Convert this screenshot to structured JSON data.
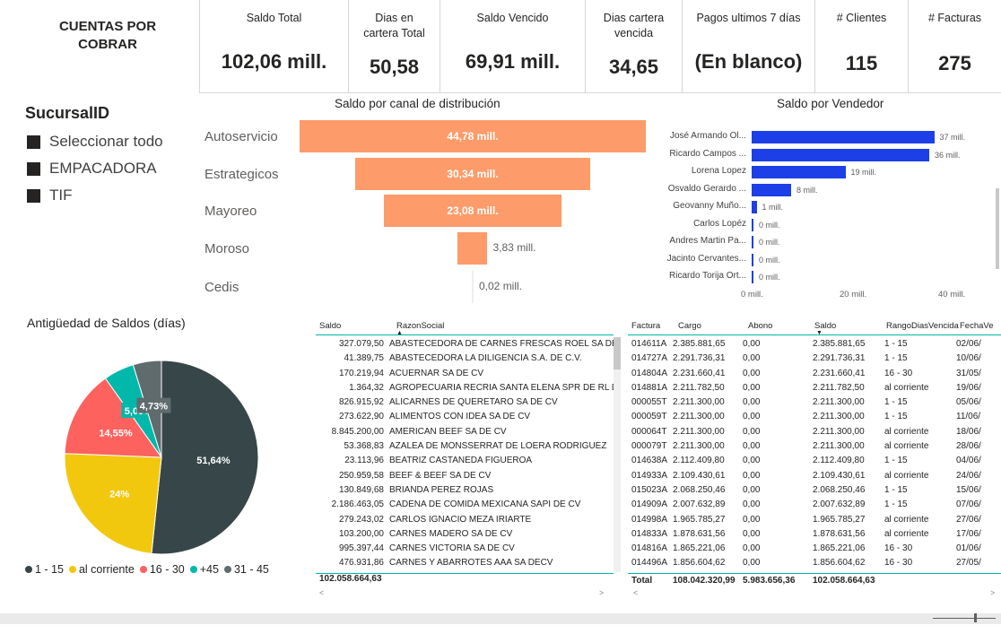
{
  "report_title": "CUENTAS POR COBRAR",
  "cards": [
    {
      "label": "Saldo Total",
      "value": "102,06 mill."
    },
    {
      "label": "Dias en cartera Total",
      "value": "50,58"
    },
    {
      "label": "Saldo Vencido",
      "value": "69,91 mill."
    },
    {
      "label": "Dias cartera vencida",
      "value": "34,65"
    },
    {
      "label": "Pagos ultimos 7 días",
      "value": "(En blanco)"
    },
    {
      "label": "# Clientes",
      "value": "115"
    },
    {
      "label": "# Facturas",
      "value": "275"
    }
  ],
  "slicer": {
    "title": "SucursalID",
    "items": [
      "Seleccionar todo",
      "EMPACADORA",
      "TIF"
    ]
  },
  "funnel": {
    "title": "Saldo por canal de distribución",
    "color": "#fd9b6a",
    "rows": [
      {
        "label": "Autoservicio",
        "value": 44.78,
        "display": "44,78 mill."
      },
      {
        "label": "Estrategicos",
        "value": 30.34,
        "display": "30,34 mill."
      },
      {
        "label": "Mayoreo",
        "value": 23.08,
        "display": "23,08 mill."
      },
      {
        "label": "Moroso",
        "value": 3.83,
        "display": "3,83 mill."
      },
      {
        "label": "Cedis",
        "value": 0.02,
        "display": "0,02 mill."
      }
    ]
  },
  "vendedor": {
    "title": "Saldo por Vendedor",
    "color": "#1c3fe8",
    "axis_ticks": [
      "0 mill.",
      "20 mill.",
      "40 mill."
    ],
    "rows": [
      {
        "label": "José Armando Ol...",
        "value": 37,
        "display": "37 mill."
      },
      {
        "label": "Ricardo Campos ...",
        "value": 36,
        "display": "36 mill."
      },
      {
        "label": "Lorena Lopez",
        "value": 19,
        "display": "19 mill."
      },
      {
        "label": "Osvaldo Gerardo ...",
        "value": 8,
        "display": "8 mill."
      },
      {
        "label": "Geovanny Muño...",
        "value": 1,
        "display": "1 mill."
      },
      {
        "label": "Carlos Lopéz",
        "value": 0,
        "display": "0 mill."
      },
      {
        "label": "Andres Martin Pa...",
        "value": 0,
        "display": "0 mill."
      },
      {
        "label": "Jacinto Cervantes...",
        "value": 0,
        "display": "0 mill."
      },
      {
        "label": "Ricardo Torija Ort...",
        "value": 0,
        "display": "0 mill."
      }
    ]
  },
  "pie": {
    "title": "Antigüedad de Saldos (días)",
    "slices": [
      {
        "name": "31 - 45",
        "value": 51.64,
        "label": "51,64%",
        "color": "#374649"
      },
      {
        "name": "al corriente",
        "value": 24,
        "label": "24%",
        "color": "#f2c80f"
      },
      {
        "name": "1 - 15",
        "value": 14.55,
        "label": "14,55%",
        "color": "#fd625e"
      },
      {
        "name": "16 - 30",
        "value": 5.09,
        "label": "5,09%",
        "color": "#01b8aa"
      },
      {
        "name": "+45",
        "value": 4.73,
        "label": "4,73%",
        "color": "#5f6b6d"
      }
    ],
    "legend": [
      {
        "name": "1 - 15",
        "color": "#374649"
      },
      {
        "name": "al corriente",
        "color": "#f2c80f"
      },
      {
        "name": "16 - 30",
        "color": "#fd625e"
      },
      {
        "name": "+45",
        "color": "#01b8aa"
      },
      {
        "name": "31 - 45",
        "color": "#5f6b6d"
      }
    ]
  },
  "table1": {
    "headers": [
      "Saldo",
      "RazonSocial"
    ],
    "rows": [
      [
        "327.079,50",
        "ABASTECEDORA DE CARNES FRESCAS ROEL SA DE C"
      ],
      [
        "41.389,75",
        "ABASTECEDORA LA DILIGENCIA S.A. DE C.V."
      ],
      [
        "170.219,94",
        "ACUERNAR SA DE CV"
      ],
      [
        "1.364,32",
        "AGROPECUARIA RECRIA SANTA ELENA SPR DE RL DE"
      ],
      [
        "826.915,92",
        "ALICARNES DE QUERETARO SA DE CV"
      ],
      [
        "273.622,90",
        "ALIMENTOS CON IDEA SA DE CV"
      ],
      [
        "8.845.200,00",
        "AMERICAN BEEF SA DE CV"
      ],
      [
        "53.368,83",
        "AZALEA DE MONSSERRAT DE LOERA RODRIGUEZ"
      ],
      [
        "23.113,96",
        "BEATRIZ CASTAÑEDA FIGUEROA"
      ],
      [
        "250.959,58",
        "BEEF & BEEF SA DE CV"
      ],
      [
        "130.849,68",
        "BRIANDA PEREZ ROJAS"
      ],
      [
        "2.186.463,05",
        "CADENA DE COMIDA MEXICANA SAPI DE CV"
      ],
      [
        "279.243,02",
        "CARLOS IGNACIO MEZA IRIARTE"
      ],
      [
        "103.200,00",
        "CARNES MADERO SA DE CV"
      ],
      [
        "995.397,44",
        "CARNES VICTORIA SA DE CV"
      ],
      [
        "476.931,86",
        "CARNES Y ABARROTES AAA SA DECV"
      ]
    ],
    "total": "102.058.664,63"
  },
  "table2": {
    "headers": [
      "Factura",
      "Cargo",
      "Abono",
      "Saldo",
      "RangoDiasVencida",
      "FechaVe"
    ],
    "rows": [
      [
        "014611A",
        "2.385.881,65",
        "0,00",
        "2.385.881,65",
        "1 - 15",
        "02/06/"
      ],
      [
        "014727A",
        "2.291.736,31",
        "0,00",
        "2.291.736,31",
        "1 - 15",
        "10/06/"
      ],
      [
        "014804A",
        "2.231.660,41",
        "0,00",
        "2.231.660,41",
        "16 - 30",
        "31/05/"
      ],
      [
        "014881A",
        "2.211.782,50",
        "0,00",
        "2.211.782,50",
        "al corriente",
        "19/06/"
      ],
      [
        "000055T",
        "2.211.300,00",
        "0,00",
        "2.211.300,00",
        "1 - 15",
        "05/06/"
      ],
      [
        "000059T",
        "2.211.300,00",
        "0,00",
        "2.211.300,00",
        "1 - 15",
        "11/06/"
      ],
      [
        "000064T",
        "2.211.300,00",
        "0,00",
        "2.211.300,00",
        "al corriente",
        "18/06/"
      ],
      [
        "000079T",
        "2.211.300,00",
        "0,00",
        "2.211.300,00",
        "al corriente",
        "28/06/"
      ],
      [
        "014638A",
        "2.112.409,80",
        "0,00",
        "2.112.409,80",
        "1 - 15",
        "04/06/"
      ],
      [
        "014933A",
        "2.109.430,61",
        "0,00",
        "2.109.430,61",
        "al corriente",
        "24/06/"
      ],
      [
        "015023A",
        "2.068.250,46",
        "0,00",
        "2.068.250,46",
        "1 - 15",
        "15/06/"
      ],
      [
        "014909A",
        "2.007.632,89",
        "0,00",
        "2.007.632,89",
        "1 - 15",
        "07/06/"
      ],
      [
        "014998A",
        "1.965.785,27",
        "0,00",
        "1.965.785,27",
        "al corriente",
        "27/06/"
      ],
      [
        "014833A",
        "1.878.631,56",
        "0,00",
        "1.878.631,56",
        "al corriente",
        "17/06/"
      ],
      [
        "014816A",
        "1.865.221,06",
        "0,00",
        "1.865.221,06",
        "16 - 30",
        "01/06/"
      ],
      [
        "014496A",
        "1.856.604,62",
        "0,00",
        "1.856.604,62",
        "16 - 30",
        "27/05/"
      ]
    ],
    "total": [
      "Total",
      "108.042.320,99",
      "5.983.656,36",
      "102.058.664,63"
    ]
  }
}
